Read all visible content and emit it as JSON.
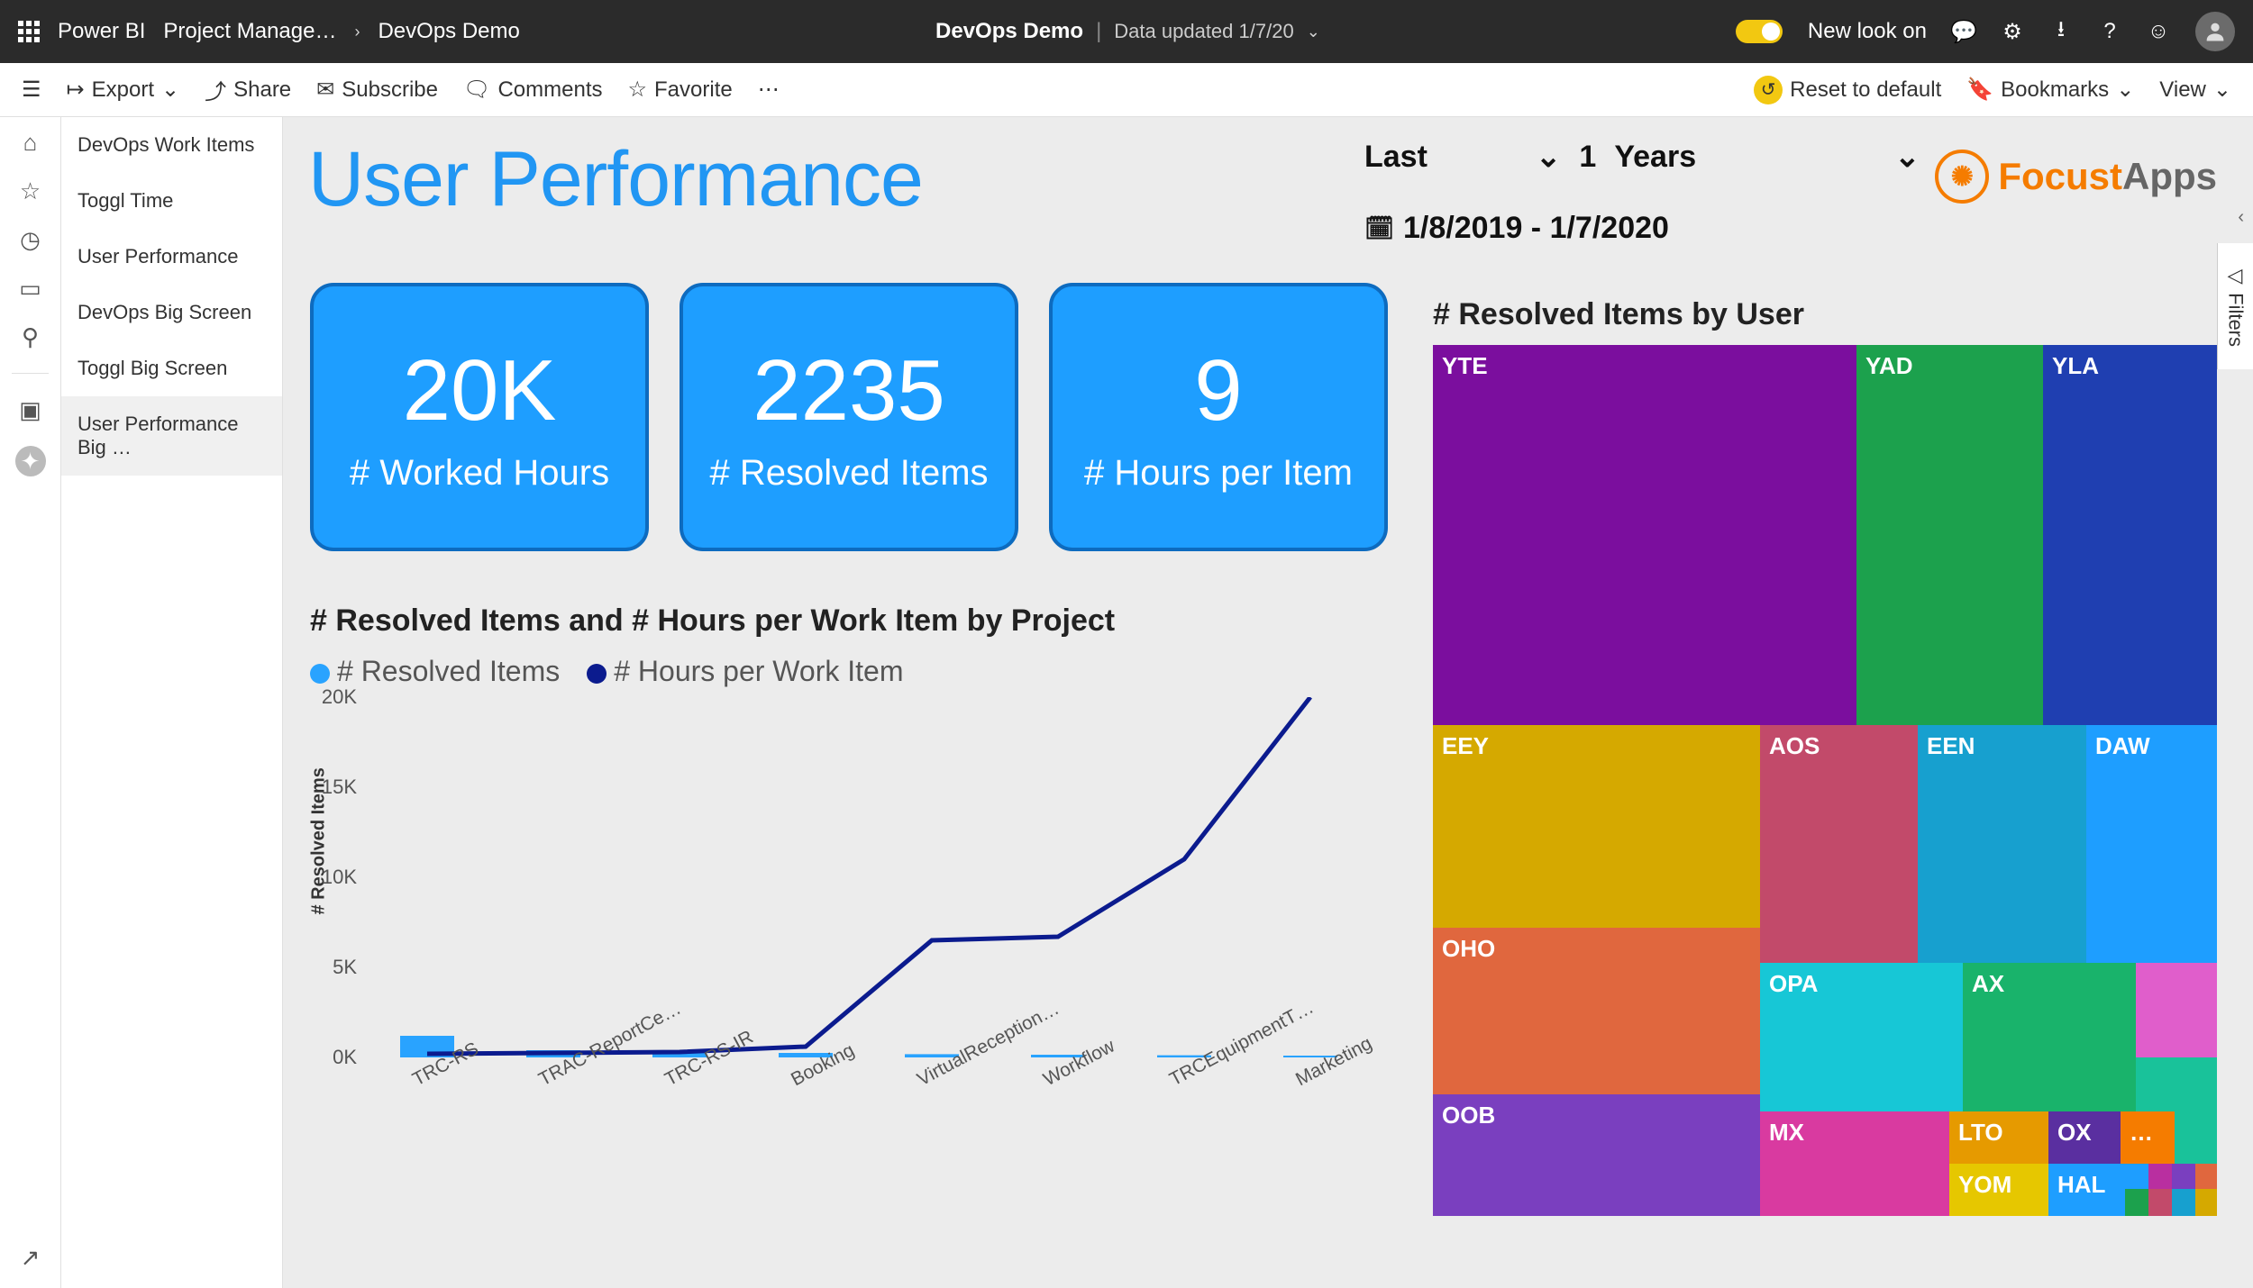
{
  "header": {
    "app": "Power BI",
    "workspace": "Project Manage…",
    "report": "DevOps Demo",
    "center_title": "DevOps Demo",
    "data_updated": "Data updated 1/7/20",
    "new_look": "New look on"
  },
  "toolbar": {
    "export": "Export",
    "share": "Share",
    "subscribe": "Subscribe",
    "comments": "Comments",
    "favorite": "Favorite",
    "reset": "Reset to default",
    "bookmarks": "Bookmarks",
    "view": "View"
  },
  "pages": [
    "DevOps Work Items",
    "Toggl Time",
    "User Performance",
    "DevOps Big Screen",
    "Toggl Big Screen",
    "User Performance Big …"
  ],
  "active_page_index": 5,
  "report_title": "User Performance",
  "slicers": {
    "rel": "Last",
    "num": "1",
    "unit": "Years"
  },
  "date_range": "1/8/2019 - 1/7/2020",
  "brand": {
    "name1": "Focust",
    "name2": "Apps"
  },
  "cards": [
    {
      "value": "20K",
      "label": "# Worked Hours"
    },
    {
      "value": "2235",
      "label": "# Resolved Items"
    },
    {
      "value": "9",
      "label": "# Hours per Item"
    }
  ],
  "combo_chart": {
    "title": "# Resolved Items and # Hours per Work Item by Project",
    "legend": [
      "# Resolved Items",
      "# Hours per Work Item"
    ],
    "colors": [
      "#29a3ff",
      "#0b1b8e"
    ],
    "ylabel": "# Resolved Items"
  },
  "treemap": {
    "title": "# Resolved Items by User"
  },
  "filters_label": "Filters",
  "chart_data": [
    {
      "type": "bar+line",
      "title": "# Resolved Items and # Hours per Work Item by Project",
      "ylabel": "# Resolved Items",
      "yticks": [
        0,
        5000,
        10000,
        15000,
        20000
      ],
      "ytick_labels": [
        "0K",
        "5K",
        "10K",
        "15K",
        "20K"
      ],
      "ylim": [
        0,
        20000
      ],
      "categories": [
        "TRC-RS",
        "TRAC-ReportCe…",
        "TRC-RS-IR",
        "Booking",
        "VirtualReception…",
        "Workflow",
        "TRCEquipmentT…",
        "Marketing"
      ],
      "series": [
        {
          "name": "# Resolved Items",
          "type": "bar",
          "color": "#29a3ff",
          "values": [
            1200,
            400,
            300,
            250,
            180,
            150,
            120,
            100
          ]
        },
        {
          "name": "# Hours per Work Item",
          "type": "line",
          "color": "#0b1b8e",
          "values": [
            200,
            250,
            300,
            600,
            6500,
            6700,
            11000,
            20000
          ]
        }
      ]
    },
    {
      "type": "treemap",
      "title": "# Resolved Items by User",
      "items": [
        {
          "name": "YTE",
          "value": 360,
          "color": "#7b0e9e"
        },
        {
          "name": "YAD",
          "value": 160,
          "color": "#1ca14d"
        },
        {
          "name": "YLA",
          "value": 140,
          "color": "#1f3fb1"
        },
        {
          "name": "EEY",
          "value": 135,
          "color": "#d5a900"
        },
        {
          "name": "AOS",
          "value": 90,
          "color": "#c24a6a"
        },
        {
          "name": "EEN",
          "value": 80,
          "color": "#17a0cf"
        },
        {
          "name": "DAW",
          "value": 70,
          "color": "#1e9eff"
        },
        {
          "name": "OHO",
          "value": 120,
          "color": "#e0673e"
        },
        {
          "name": "OOB",
          "value": 95,
          "color": "#7a3fbf"
        },
        {
          "name": "OPA",
          "value": 75,
          "color": "#17c7d6"
        },
        {
          "name": "AX",
          "value": 55,
          "color": "#19b36b"
        },
        {
          "name": "MX",
          "value": 70,
          "color": "#d93aa0"
        },
        {
          "name": "LTO",
          "value": 30,
          "color": "#e69a00"
        },
        {
          "name": "OX",
          "value": 22,
          "color": "#5a2fa0"
        },
        {
          "name": "…",
          "value": 18,
          "color": "#f57c00"
        },
        {
          "name": "YOM",
          "value": 20,
          "color": "#e6c700"
        },
        {
          "name": "HAL",
          "value": 18,
          "color": "#1e9eff"
        },
        {
          "name": "",
          "value": 10,
          "color": "#e05ecb"
        },
        {
          "name": "",
          "value": 8,
          "color": "#19c29a"
        },
        {
          "name": "",
          "value": 6,
          "color": "#1e9eff"
        },
        {
          "name": "",
          "value": 5,
          "color": "#b92fa0"
        },
        {
          "name": "",
          "value": 4,
          "color": "#e0673e"
        }
      ]
    }
  ]
}
